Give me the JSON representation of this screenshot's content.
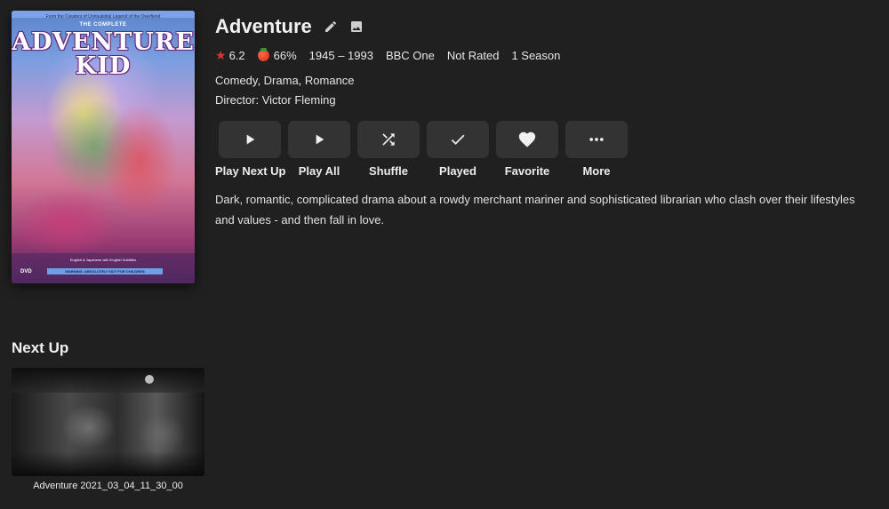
{
  "poster": {
    "tagline": "From the Creators of Urotsukidoji Legend of the Overfiend",
    "pre_title": "THE COMPLETE",
    "title_line1": "ADVENTURE",
    "title_line2": "KID",
    "note": "English & Japanese with English Subtitles",
    "warning": "WARNING: ABSOLUTELY NOT FOR CHILDREN",
    "format": "DVD"
  },
  "header": {
    "title": "Adventure",
    "edit_icon": "pencil-icon",
    "image_icon": "image-icon"
  },
  "meta": {
    "community_rating": "6.2",
    "critic_rating": "66%",
    "years": "1945 – 1993",
    "network": "BBC One",
    "official_rating": "Not Rated",
    "seasons": "1 Season",
    "star_color": "#e03131",
    "tomato_color": "#d42a12"
  },
  "genres": "Comedy, Drama, Romance",
  "director": "Director: Victor Fleming",
  "actions": [
    {
      "label": "Play Next Up",
      "icon": "play-icon"
    },
    {
      "label": "Play All",
      "icon": "play-icon"
    },
    {
      "label": "Shuffle",
      "icon": "shuffle-icon"
    },
    {
      "label": "Played",
      "icon": "check-icon"
    },
    {
      "label": "Favorite",
      "icon": "heart-icon"
    },
    {
      "label": "More",
      "icon": "more-icon"
    }
  ],
  "overview": "Dark, romantic, complicated drama about a rowdy merchant mariner and sophisticated librarian who clash over their lifestyles and values - and then fall in love.",
  "next_up": {
    "heading": "Next Up",
    "item_title": "Adventure 2021_03_04_11_30_00"
  }
}
